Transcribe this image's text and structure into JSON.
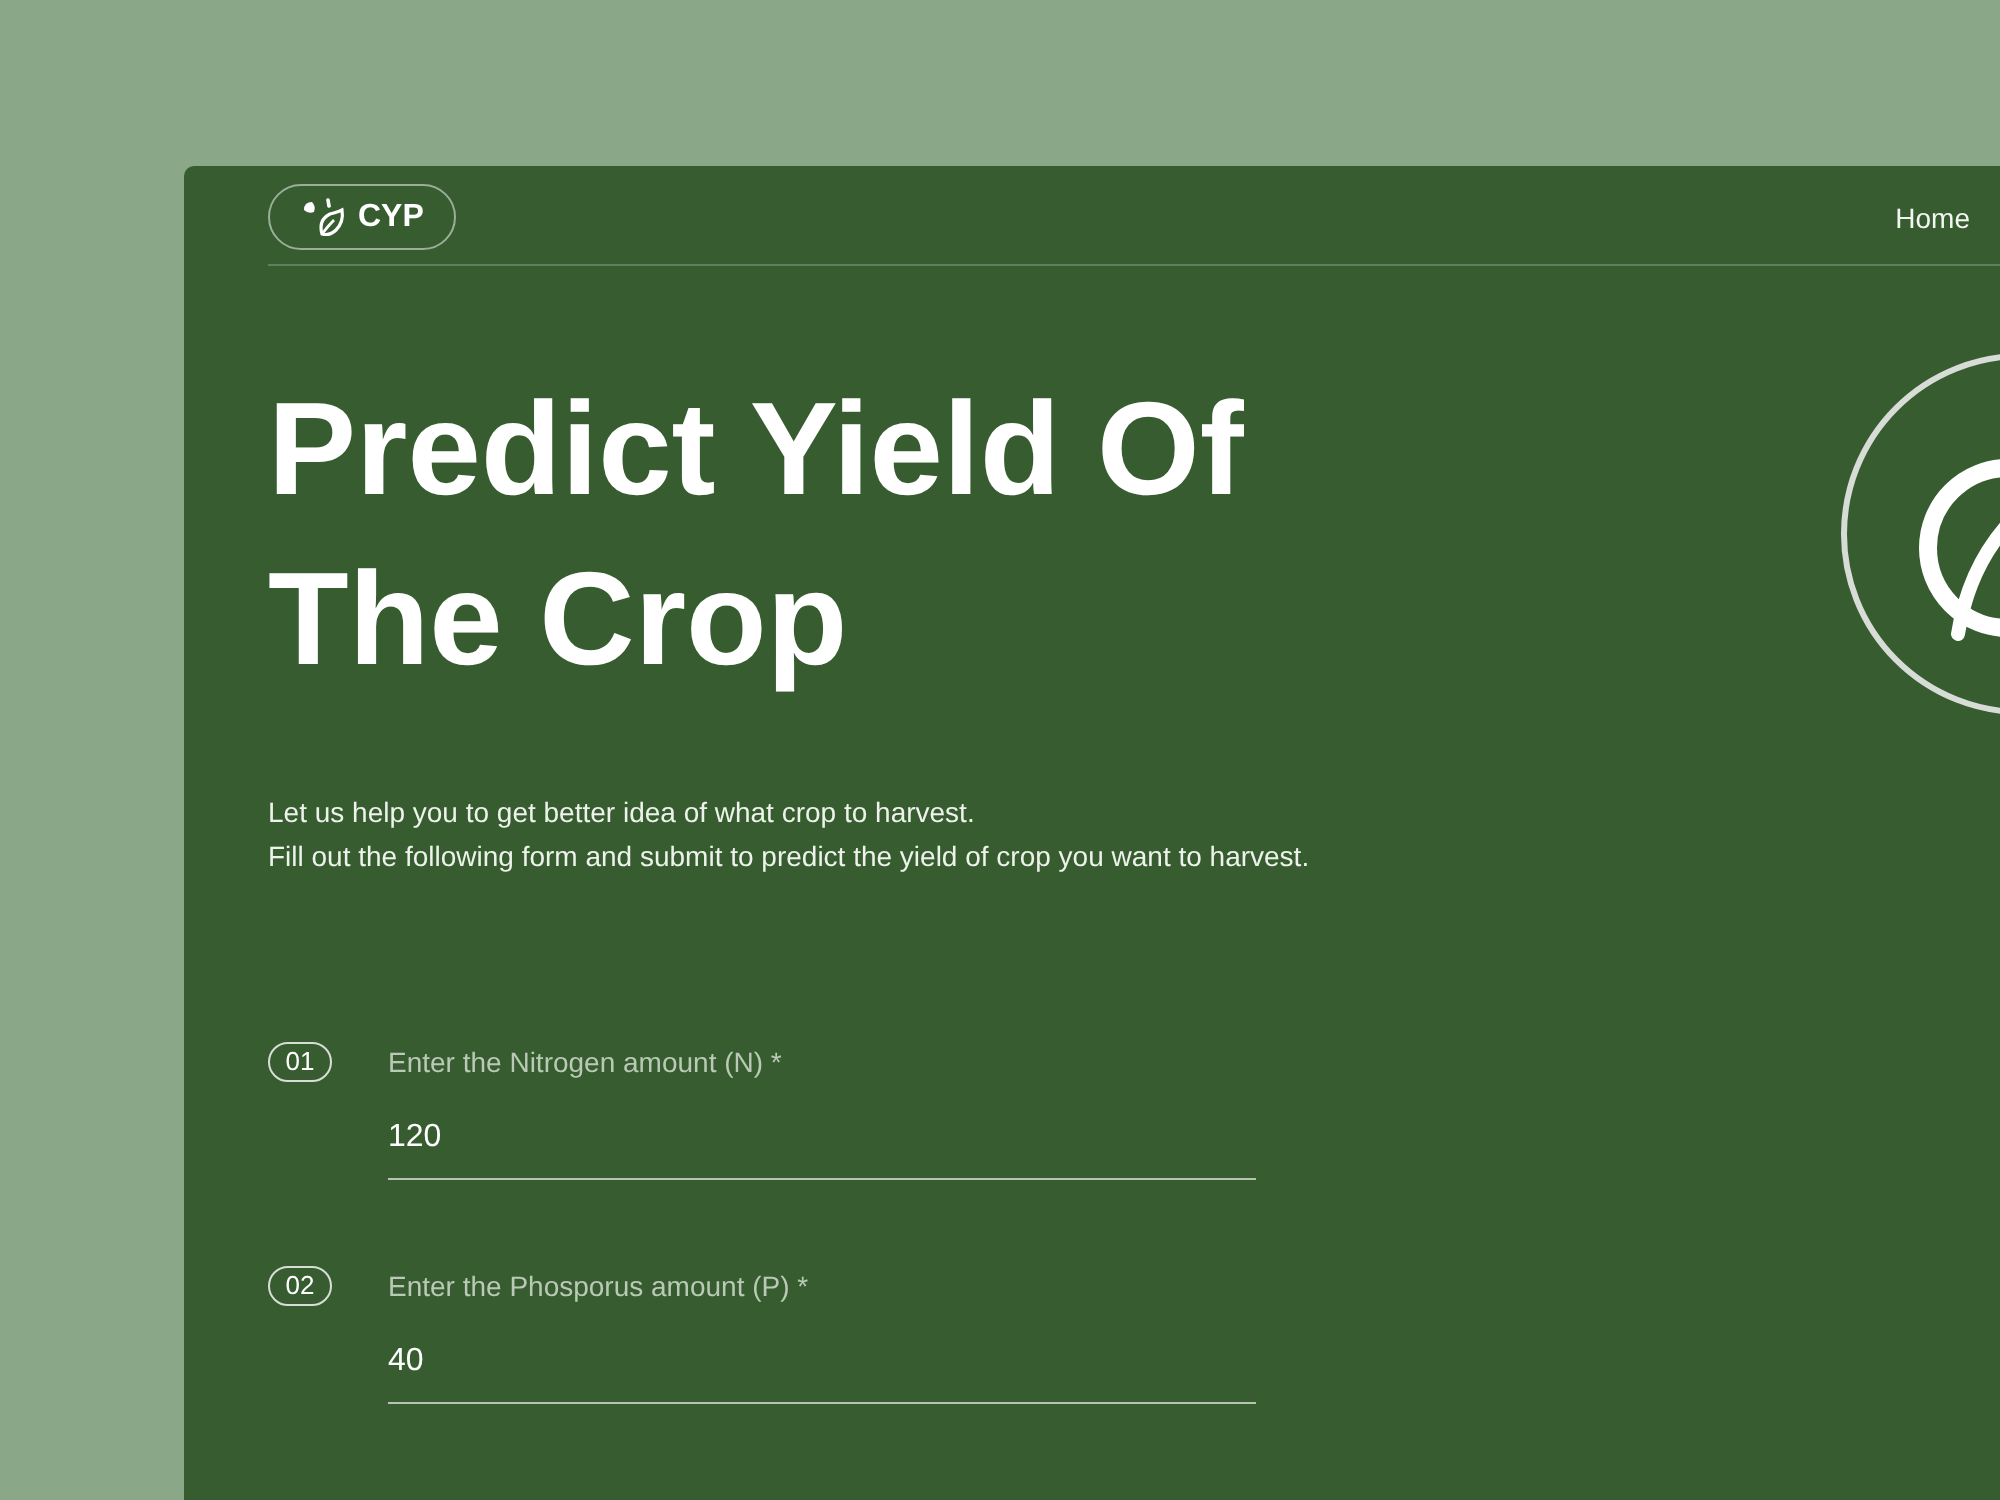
{
  "nav": {
    "logo": {
      "text": "CYP"
    },
    "links": [
      {
        "label": "Home"
      }
    ]
  },
  "hero": {
    "title": "Predict Yield Of The Crop",
    "intro": [
      "Let us help you to get better idea of what crop to harvest.",
      "Fill out the following form and submit to predict the yield of crop you want to harvest."
    ]
  },
  "form": {
    "fields": [
      {
        "number": "01",
        "label": "Enter the Nitrogen amount (N) *",
        "value": "120"
      },
      {
        "number": "02",
        "label": "Enter the Phosporus amount (P) *",
        "value": "40"
      }
    ]
  }
}
